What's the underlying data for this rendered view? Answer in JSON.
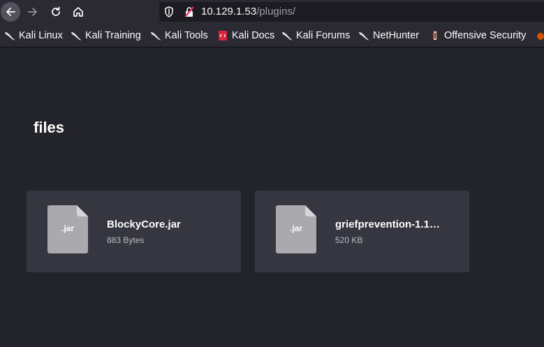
{
  "browser": {
    "url_host": "10.129.1.53",
    "url_path": "/plugins/"
  },
  "bookmarks": [
    {
      "label": "Kali Linux",
      "icon": "kali-dragon-icon"
    },
    {
      "label": "Kali Training",
      "icon": "kali-dragon-icon"
    },
    {
      "label": "Kali Tools",
      "icon": "kali-dragon-icon"
    },
    {
      "label": "Kali Docs",
      "icon": "kali-docs-icon"
    },
    {
      "label": "Kali Forums",
      "icon": "kali-dragon-icon"
    },
    {
      "label": "NetHunter",
      "icon": "kali-dragon-icon"
    },
    {
      "label": "Offensive Security",
      "icon": "offsec-icon"
    }
  ],
  "page": {
    "title": "files",
    "files": [
      {
        "ext": ".jar",
        "name": "BlockyCore.jar",
        "size": "883 Bytes"
      },
      {
        "ext": ".jar",
        "name": "griefprevention-1.1…",
        "size": "520 KB"
      }
    ]
  },
  "colors": {
    "page_bg": "#23232b",
    "card_bg": "#363640",
    "file_icon": "#a9a9ae",
    "toolbar_bg": "#2b2a33"
  }
}
